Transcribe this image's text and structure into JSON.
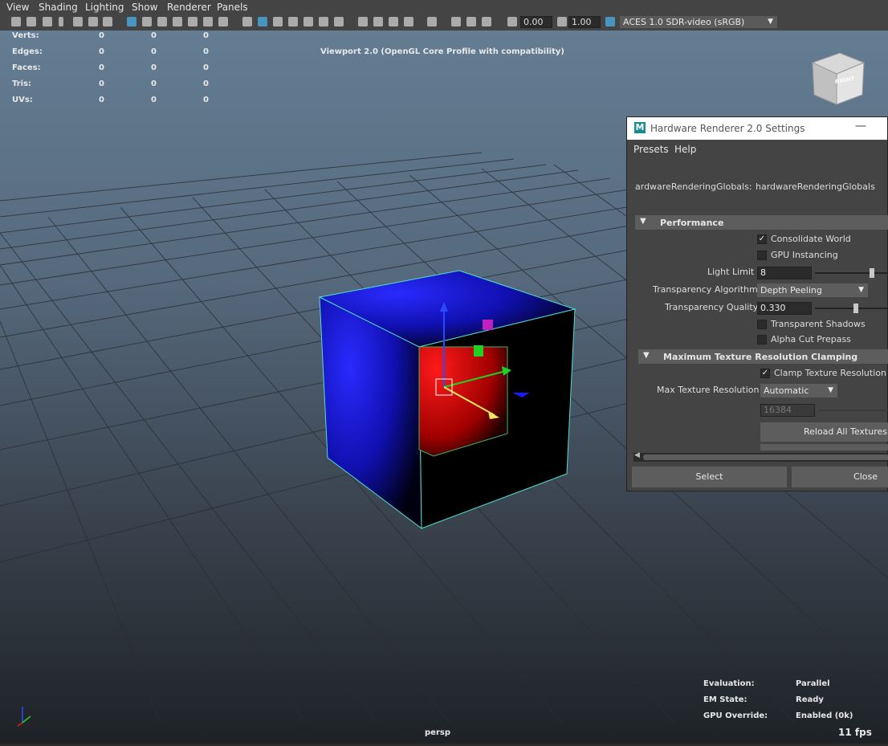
{
  "menubar": {
    "items": [
      "View",
      "Shading",
      "Lighting",
      "Show",
      "Renderer",
      "Panels"
    ]
  },
  "toolbar": {
    "exposure_value": "0.00",
    "gamma_value": "1.00",
    "color_space": "ACES 1.0 SDR-video (sRGB)"
  },
  "hud": {
    "stats": [
      {
        "label": "Verts:",
        "values": [
          "0",
          "0",
          "0"
        ]
      },
      {
        "label": "Edges:",
        "values": [
          "0",
          "0",
          "0"
        ]
      },
      {
        "label": "Faces:",
        "values": [
          "0",
          "0",
          "0"
        ]
      },
      {
        "label": "Tris:",
        "values": [
          "0",
          "0",
          "0"
        ]
      },
      {
        "label": "UVs:",
        "values": [
          "0",
          "0",
          "0"
        ]
      }
    ],
    "viewport_title": "Viewport 2.0 (OpenGL Core Profile with compatibility)",
    "viewcube_label": "RIGHT",
    "camera_name": "persp",
    "fps": "11 fps",
    "evaluation_label": "Evaluation:",
    "evaluation_value": "Parallel",
    "em_state_label": "EM State:",
    "em_state_value": "Ready",
    "gpu_override_label": "GPU Override:",
    "gpu_override_value": "Enabled (0k)"
  },
  "dialog": {
    "title": "Hardware Renderer 2.0 Settings",
    "menu": [
      "Presets",
      "Help"
    ],
    "globals_label": "ardwareRenderingGlobals:",
    "globals_value": "hardwareRenderingGlobals",
    "performance_header": "Performance",
    "consolidate_world": {
      "label": "Consolidate World",
      "checked": true
    },
    "gpu_instancing": {
      "label": "GPU Instancing",
      "checked": false
    },
    "light_limit_label": "Light Limit",
    "light_limit_value": "8",
    "light_limit_slider": 0.9,
    "transparency_algorithm_label": "Transparency Algorithm",
    "transparency_algorithm_value": "Depth Peeling",
    "transparency_quality_label": "Transparency Quality",
    "transparency_quality_value": "0.330",
    "transparency_quality_slider": 0.33,
    "transparent_shadows": {
      "label": "Transparent Shadows",
      "checked": false
    },
    "alpha_cut_prepass": {
      "label": "Alpha Cut Prepass",
      "checked": false
    },
    "texture_clamp_header": "Maximum Texture Resolution Clamping",
    "clamp_texture_resolution": {
      "label": "Clamp Texture Resolution",
      "checked": true
    },
    "max_texture_resolution_label": "Max Texture Resolution",
    "max_texture_resolution_value": "Automatic",
    "texture_size_value": "16384",
    "reload_textures_label": "Reload All Textures",
    "select_label": "Select",
    "close_label": "Close"
  },
  "colors": {
    "accent": "#4aa3d6",
    "cube_outer": "#1f1ff0",
    "cube_inner": "#e00000",
    "selection": "#4fe0d0"
  }
}
